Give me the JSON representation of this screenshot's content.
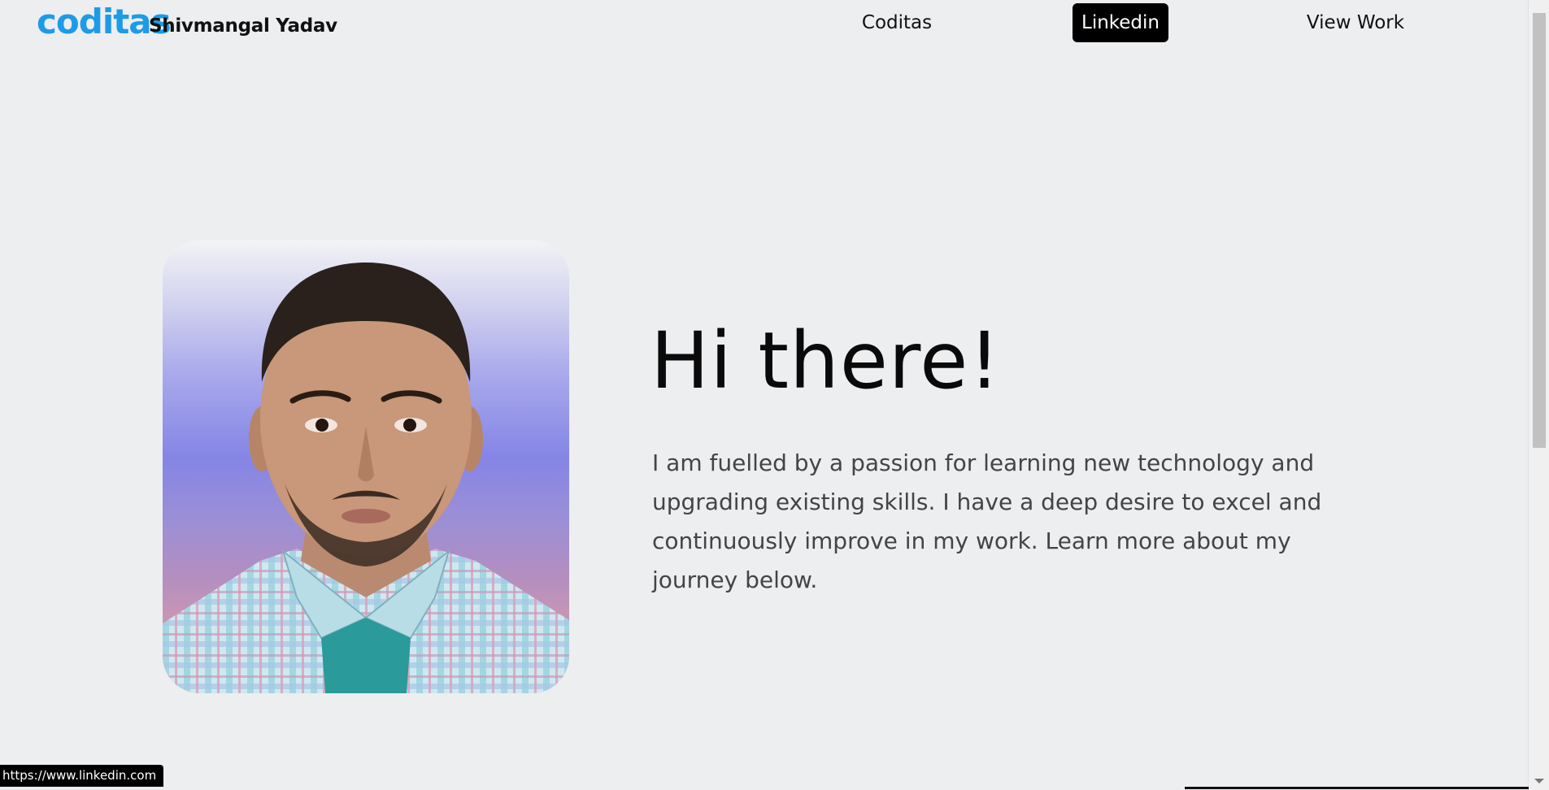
{
  "header": {
    "logo_text": "coditas",
    "brand_name": "Shivmangal Yadav",
    "nav": [
      {
        "label": "Coditas"
      },
      {
        "label": "Linkedin"
      },
      {
        "label": "View Work"
      }
    ]
  },
  "hero": {
    "title": "Hi there!",
    "description": "I am fuelled by a passion for learning new technology and upgrading existing skills. I have a deep desire to excel and continuously improve in my work. Learn more about my journey below."
  },
  "status_bar": {
    "url": "https://www.linkedin.com"
  },
  "colors": {
    "logo": "#1d9be6",
    "background": "#edeef0",
    "active_nav_bg": "#000000"
  }
}
